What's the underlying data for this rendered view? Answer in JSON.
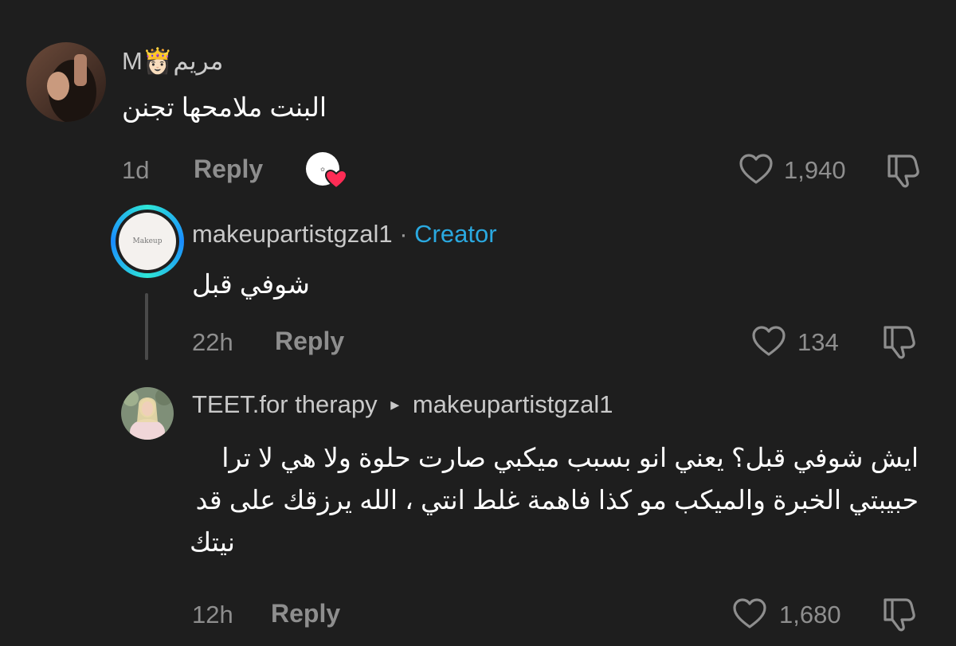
{
  "comments": [
    {
      "author": "M👸🏻مريم",
      "text": "البنت ملامحها تجنن",
      "age": "1d",
      "reply_label": "Reply",
      "likes": "1,940"
    },
    {
      "author": "makeupartistgzal1",
      "separator": "·",
      "badge": "Creator",
      "avatar_text": "Makeup",
      "text": "شوفي قبل",
      "age": "22h",
      "reply_label": "Reply",
      "likes": "134"
    },
    {
      "author": "TEET.for therapy",
      "reply_to_arrow": "▸",
      "reply_to": "makeupartistgzal1",
      "text_lines": [
        "ايش شوفي قبل؟ يعني انو بسبب ميكبي صارت حلوة ولا هي لا ترا",
        "حبيبتي الخبرة والميكب مو كذا فاهمة غلط انتي ، الله يرزقك على قد",
        "نيتك"
      ],
      "age": "12h",
      "reply_label": "Reply",
      "likes": "1,680"
    }
  ],
  "icons": {
    "like": "heart-outline-icon",
    "dislike": "thumbs-down-icon",
    "creator_liked": "creator-liked-heart-icon"
  },
  "colors": {
    "background": "#1e1e1e",
    "creator_badge": "#2aa9e0",
    "heart_badge": "#fe2c55",
    "meta_text": "#8e8e8e"
  }
}
